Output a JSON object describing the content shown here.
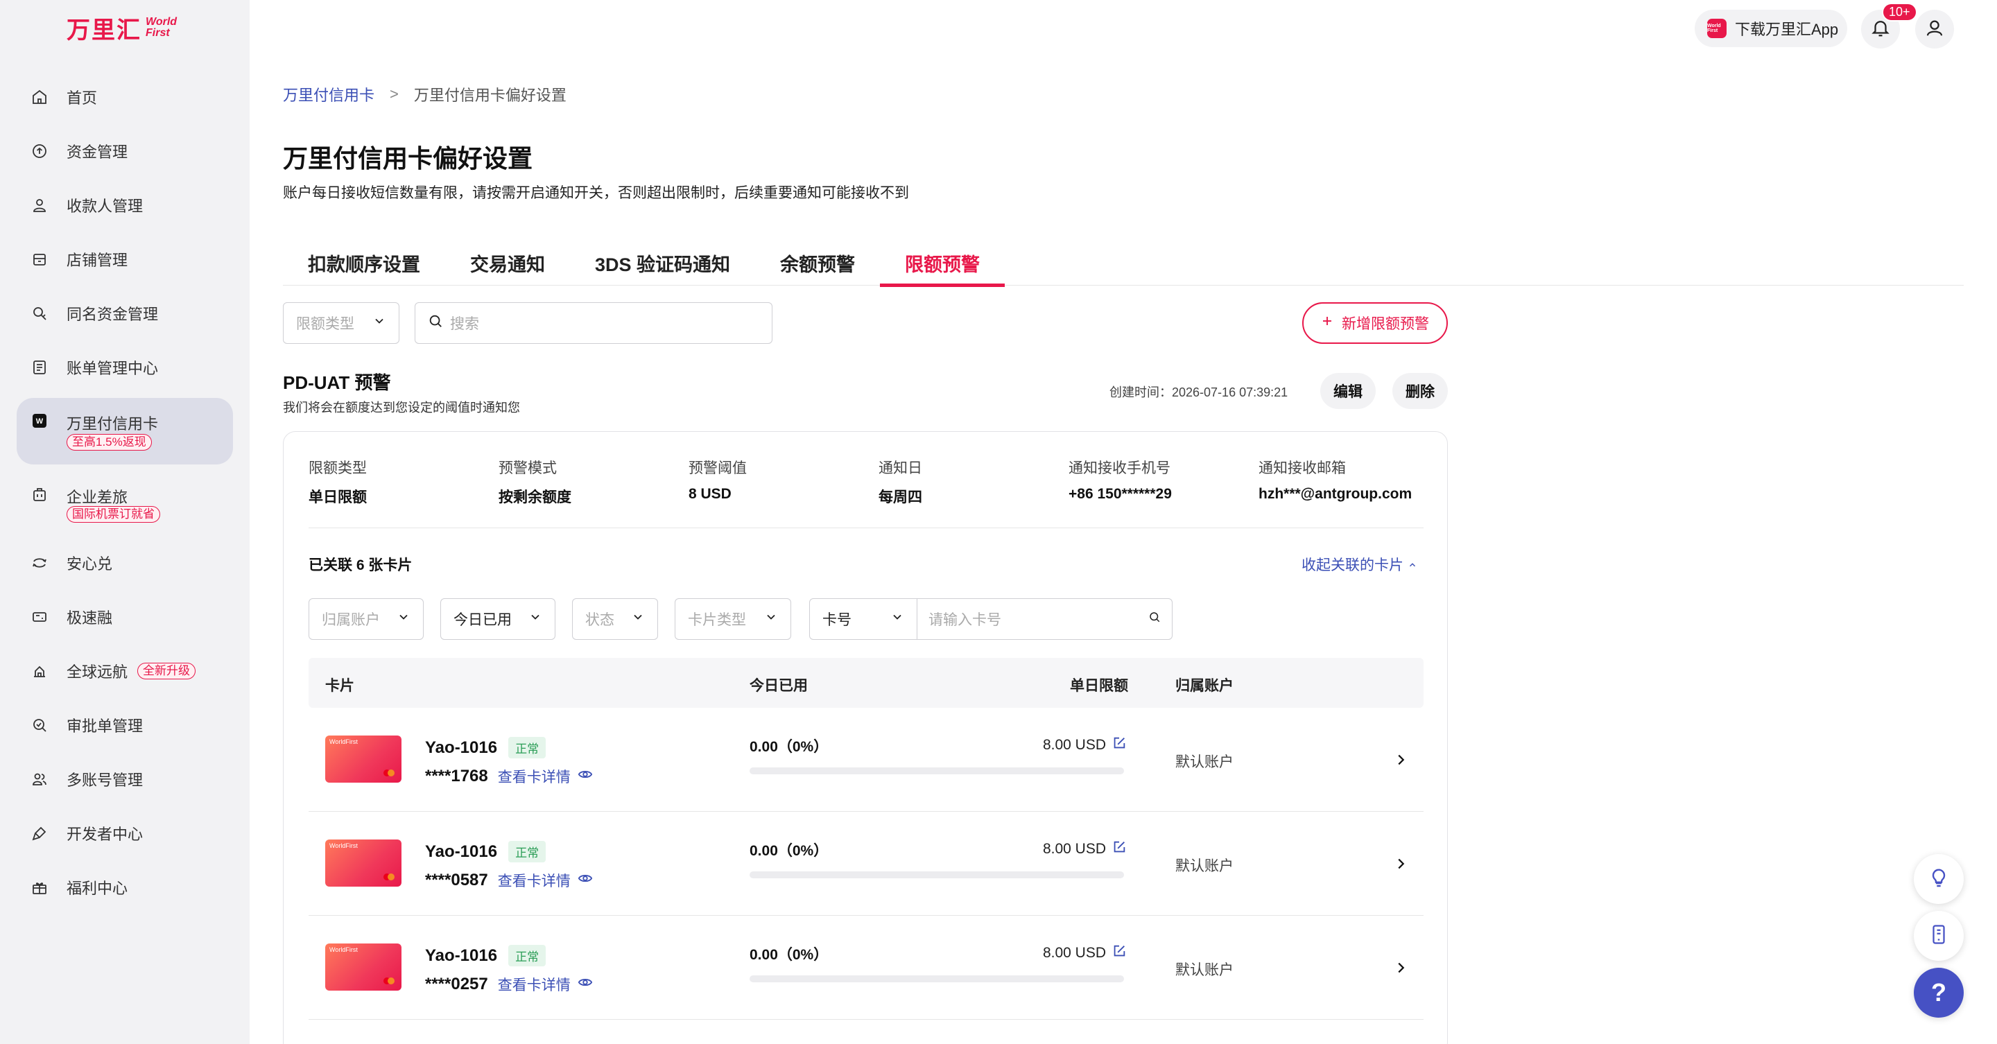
{
  "brand": {
    "cn": "万里汇",
    "en_line1": "World",
    "en_line2": "First"
  },
  "sidebar": {
    "items": [
      {
        "label": "首页",
        "icon": "home-icon"
      },
      {
        "label": "资金管理",
        "icon": "fund-icon"
      },
      {
        "label": "收款人管理",
        "icon": "payee-icon"
      },
      {
        "label": "店铺管理",
        "icon": "shop-icon"
      },
      {
        "label": "同名资金管理",
        "icon": "same-name-fund-icon"
      },
      {
        "label": "账单管理中心",
        "icon": "bill-icon"
      },
      {
        "label": "万里付信用卡",
        "icon": "card-icon",
        "tag": "至高1.5%返现",
        "active": true
      },
      {
        "label": "企业差旅",
        "icon": "travel-icon",
        "tag": "国际机票订就省"
      },
      {
        "label": "安心兑",
        "icon": "exchange-icon"
      },
      {
        "label": "极速融",
        "icon": "finance-icon"
      },
      {
        "label": "全球远航",
        "icon": "global-icon",
        "tag": "全新升级"
      },
      {
        "label": "审批单管理",
        "icon": "approval-icon"
      },
      {
        "label": "多账号管理",
        "icon": "multi-account-icon"
      },
      {
        "label": "开发者中心",
        "icon": "developer-icon"
      },
      {
        "label": "福利中心",
        "icon": "gift-icon"
      }
    ]
  },
  "topbar": {
    "download_label": "下载万里汇App",
    "app_icon_text": "World First",
    "notification_badge": "10+"
  },
  "breadcrumb": {
    "parent": "万里付信用卡",
    "separator": ">",
    "current": "万里付信用卡偏好设置"
  },
  "page": {
    "title": "万里付信用卡偏好设置",
    "description": "账户每日接收短信数量有限，请按需开启通知开关，否则超出限制时，后续重要通知可能接收不到"
  },
  "tabs": [
    {
      "label": "扣款顺序设置",
      "active": false
    },
    {
      "label": "交易通知",
      "active": false
    },
    {
      "label": "3DS 验证码通知",
      "active": false
    },
    {
      "label": "余额预警",
      "active": false
    },
    {
      "label": "限额预警",
      "active": true
    }
  ],
  "filters": {
    "limit_type_placeholder": "限额类型",
    "search_placeholder": "搜索",
    "add_button": "新增限额预警"
  },
  "alert": {
    "title": "PD-UAT 预警",
    "description": "我们将会在额度达到您设定的阈值时通知您",
    "created": "创建时间：2026-07-16 07:39:21",
    "edit_label": "编辑",
    "delete_label": "删除",
    "info": [
      {
        "key": "限额类型",
        "value": "单日限额"
      },
      {
        "key": "预警模式",
        "value": "按剩余额度"
      },
      {
        "key": "预警阈值",
        "value": "8 USD"
      },
      {
        "key": "通知日",
        "value": "每周四"
      },
      {
        "key": "通知接收手机号",
        "value": "+86 150******29"
      },
      {
        "key": "通知接收邮箱",
        "value": "hzh***@antgroup.com"
      }
    ],
    "linked_count": "已关联 6 张卡片",
    "collapse_label": "收起关联的卡片"
  },
  "card_filters": {
    "account_placeholder": "归属账户",
    "used_today": "今日已用",
    "status_placeholder": "状态",
    "card_type_placeholder": "卡片类型",
    "card_number_select": "卡号",
    "card_number_placeholder": "请输入卡号"
  },
  "table": {
    "headers": {
      "card": "卡片",
      "used_today": "今日已用",
      "daily_limit": "单日限额",
      "account": "归属账户"
    },
    "rows": [
      {
        "name": "Yao-1016",
        "status": "正常",
        "number": "****1768",
        "detail_label": "查看卡详情",
        "used": "0.00（0%）",
        "used_fraction": 0,
        "limit": "8.00 USD",
        "account": "默认账户",
        "card_brand": "WorldFirst"
      },
      {
        "name": "Yao-1016",
        "status": "正常",
        "number": "****0587",
        "detail_label": "查看卡详情",
        "used": "0.00（0%）",
        "used_fraction": 0,
        "limit": "8.00 USD",
        "account": "默认账户",
        "card_brand": "WorldFirst"
      },
      {
        "name": "Yao-1016",
        "status": "正常",
        "number": "****0257",
        "detail_label": "查看卡详情",
        "used": "0.00（0%）",
        "used_fraction": 0,
        "limit": "8.00 USD",
        "account": "默认账户",
        "card_brand": "WorldFirst"
      }
    ]
  },
  "floating": {
    "help_label": "?"
  },
  "colors": {
    "brand_red": "#e8184a",
    "link_blue": "#3b4fb5",
    "sidebar_bg": "#f2f2f4",
    "status_green": "#2a9d56"
  }
}
